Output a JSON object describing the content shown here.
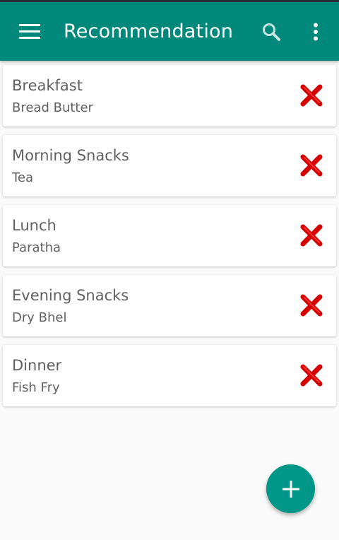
{
  "appbar": {
    "title": "Recommendation",
    "menu_icon": "hamburger-menu-icon",
    "search_icon": "search-icon",
    "overflow_icon": "more-vertical-icon",
    "color": "#00897b"
  },
  "meals": [
    {
      "label": "Breakfast",
      "item": "Bread Butter"
    },
    {
      "label": "Morning Snacks",
      "item": "Tea"
    },
    {
      "label": "Lunch",
      "item": "Paratha"
    },
    {
      "label": "Evening Snacks",
      "item": "Dry Bhel"
    },
    {
      "label": "Dinner",
      "item": "Fish Fry"
    }
  ],
  "delete_icon": "red-x-icon",
  "fab": {
    "icon": "plus-icon",
    "color": "#009688"
  },
  "colors": {
    "delete": "#d50000",
    "text": "#616161",
    "background": "#fafafa"
  }
}
